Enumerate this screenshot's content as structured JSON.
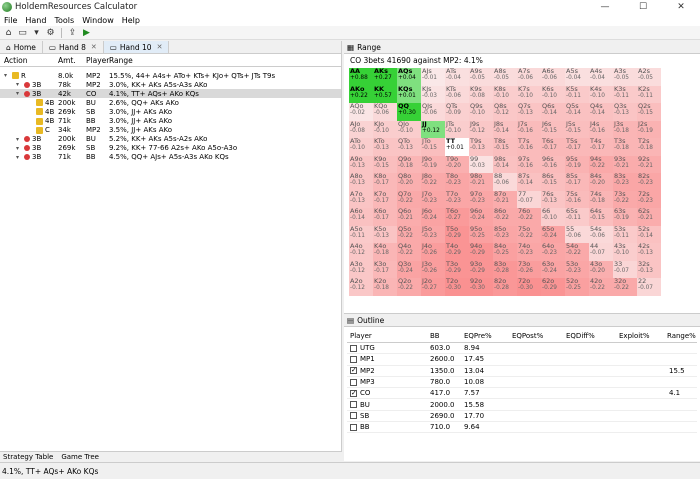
{
  "window": {
    "title": "HoldemResources Calculator"
  },
  "menu": [
    "File",
    "Hand",
    "Tools",
    "Window",
    "Help"
  ],
  "tabs": [
    {
      "label": "Home",
      "closable": false
    },
    {
      "label": "Hand 8",
      "closable": true
    },
    {
      "label": "Hand 10",
      "closable": true,
      "active": true
    }
  ],
  "tree_headers": [
    "Action",
    "Amt.",
    "Player",
    "Range"
  ],
  "tree_rows": [
    {
      "indent": 0,
      "marker": "lock",
      "action": "R",
      "amt": "8.0k",
      "player": "MP2",
      "range": "15.5%, 44+ A4s+ ATo+ KTs+ KJo+ QTs+ JTs T9s"
    },
    {
      "indent": 1,
      "marker": "dot",
      "action": "3B",
      "amt": "78k",
      "player": "MP2",
      "range": "3.0%, KK+ AKs A5s-A3s AKo"
    },
    {
      "indent": 1,
      "marker": "dot",
      "action": "3B",
      "amt": "42k",
      "player": "CO",
      "range": "4.1%, TT+ AQs+ AKo KQs",
      "selected": true
    },
    {
      "indent": 2,
      "marker": "lock",
      "action": "4B",
      "amt": "200k",
      "player": "BU",
      "range": "2.6%, QQ+ AKs AKo"
    },
    {
      "indent": 2,
      "marker": "lock",
      "action": "4B",
      "amt": "269k",
      "player": "SB",
      "range": "3.0%, JJ+ AKs AKo"
    },
    {
      "indent": 2,
      "marker": "lock",
      "action": "4B",
      "amt": "71k",
      "player": "BB",
      "range": "3.0%, JJ+ AKs AKo"
    },
    {
      "indent": 2,
      "marker": "lock",
      "action": "C",
      "amt": "34k",
      "player": "MP2",
      "range": "3.5%, JJ+ AKs AKo"
    },
    {
      "indent": 1,
      "marker": "dot",
      "action": "3B",
      "amt": "200k",
      "player": "BU",
      "range": "5.2%, KK+ AKs A5s-A2s AKo"
    },
    {
      "indent": 1,
      "marker": "dot",
      "action": "3B",
      "amt": "269k",
      "player": "SB",
      "range": "9.2%, KK+ 77-66 A2s+ AKo A5o-A3o"
    },
    {
      "indent": 1,
      "marker": "dot",
      "action": "3B",
      "amt": "71k",
      "player": "BB",
      "range": "4.5%, QQ+ AJs+ A5s-A3s AKo KQs"
    }
  ],
  "bottom_tabs": [
    "Strategy Table",
    "Game Tree"
  ],
  "range_panel": {
    "title": "Range",
    "subtitle": "CO 3bets 41690 against MP2: 4.1%",
    "hands": [
      [
        "AA",
        "AKs",
        "AQs",
        "AJs",
        "ATs",
        "A9s",
        "A8s",
        "A7s",
        "A6s",
        "A5s",
        "A4s",
        "A3s",
        "A2s"
      ],
      [
        "AKo",
        "KK",
        "KQs",
        "KJs",
        "KTs",
        "K9s",
        "K8s",
        "K7s",
        "K6s",
        "K5s",
        "K4s",
        "K3s",
        "K2s"
      ],
      [
        "AQo",
        "KQo",
        "QQ",
        "QJs",
        "QTs",
        "Q9s",
        "Q8s",
        "Q7s",
        "Q6s",
        "Q5s",
        "Q4s",
        "Q3s",
        "Q2s"
      ],
      [
        "AJo",
        "KJo",
        "QJo",
        "JJ",
        "JTs",
        "J9s",
        "J8s",
        "J7s",
        "J6s",
        "J5s",
        "J4s",
        "J3s",
        "J2s"
      ],
      [
        "ATo",
        "KTo",
        "QTo",
        "JTo",
        "TT",
        "T9s",
        "T8s",
        "T7s",
        "T6s",
        "T5s",
        "T4s",
        "T3s",
        "T2s"
      ],
      [
        "A9o",
        "K9o",
        "Q9o",
        "J9o",
        "T9o",
        "99",
        "98s",
        "97s",
        "96s",
        "95s",
        "94s",
        "93s",
        "92s"
      ],
      [
        "A8o",
        "K8o",
        "Q8o",
        "J8o",
        "T8o",
        "98o",
        "88",
        "87s",
        "86s",
        "85s",
        "84s",
        "83s",
        "82s"
      ],
      [
        "A7o",
        "K7o",
        "Q7o",
        "J7o",
        "T7o",
        "97o",
        "87o",
        "77",
        "76s",
        "75s",
        "74s",
        "73s",
        "72s"
      ],
      [
        "A6o",
        "K6o",
        "Q6o",
        "J6o",
        "T6o",
        "96o",
        "86o",
        "76o",
        "66",
        "65s",
        "64s",
        "63s",
        "62s"
      ],
      [
        "A5o",
        "K5o",
        "Q5o",
        "J5o",
        "T5o",
        "95o",
        "85o",
        "75o",
        "65o",
        "55",
        "54s",
        "53s",
        "52s"
      ],
      [
        "A4o",
        "K4o",
        "Q4o",
        "J4o",
        "T4o",
        "94o",
        "84o",
        "74o",
        "64o",
        "54o",
        "44",
        "43s",
        "42s"
      ],
      [
        "A3o",
        "K3o",
        "Q3o",
        "J3o",
        "T3o",
        "93o",
        "83o",
        "73o",
        "63o",
        "53o",
        "43o",
        "33",
        "32s"
      ],
      [
        "A2o",
        "K2o",
        "Q2o",
        "J2o",
        "T2o",
        "92o",
        "82o",
        "72o",
        "62o",
        "52o",
        "42o",
        "32o",
        "22"
      ]
    ],
    "values": [
      [
        "+0.88",
        "+0.27",
        "+0.04",
        "-0.01",
        "-0.04",
        "-0.05",
        "-0.05",
        "-0.06",
        "-0.06",
        "-0.04",
        "-0.04",
        "-0.05",
        "-0.05"
      ],
      [
        "+0.22",
        "+0.57",
        "+0.01",
        "-0.03",
        "-0.06",
        "-0.08",
        "-0.10",
        "-0.10",
        "-0.10",
        "-0.11",
        "-0.10",
        "-0.11",
        "-0.11"
      ],
      [
        "-0.02",
        "-0.06",
        "+0.30",
        "-0.06",
        "-0.09",
        "-0.10",
        "-0.12",
        "-0.13",
        "-0.14",
        "-0.14",
        "-0.14",
        "-0.13",
        "-0.15"
      ],
      [
        "-0.08",
        "-0.10",
        "-0.10",
        "+0.12",
        "-0.10",
        "-0.12",
        "-0.14",
        "-0.16",
        "-0.15",
        "-0.15",
        "-0.16",
        "-0.18",
        "-0.19"
      ],
      [
        "-0.10",
        "-0.13",
        "-0.13",
        "-0.15",
        "+0.01",
        "-0.13",
        "-0.15",
        "-0.16",
        "-0.17",
        "-0.17",
        "-0.17",
        "-0.18",
        "-0.18"
      ],
      [
        "-0.13",
        "-0.15",
        "-0.18",
        "-0.19",
        "-0.20",
        "-0.03",
        "-0.14",
        "-0.16",
        "-0.16",
        "-0.19",
        "-0.22",
        "-0.21",
        "-0.21"
      ],
      [
        "-0.13",
        "-0.17",
        "-0.20",
        "-0.22",
        "-0.23",
        "-0.21",
        "-0.06",
        "-0.14",
        "-0.15",
        "-0.17",
        "-0.20",
        "-0.23",
        "-0.23"
      ],
      [
        "-0.13",
        "-0.17",
        "-0.22",
        "-0.23",
        "-0.23",
        "-0.23",
        "-0.21",
        "-0.07",
        "-0.13",
        "-0.16",
        "-0.18",
        "-0.22",
        "-0.23"
      ],
      [
        "-0.14",
        "-0.17",
        "-0.21",
        "-0.24",
        "-0.27",
        "-0.24",
        "-0.22",
        "-0.22",
        "-0.10",
        "-0.11",
        "-0.15",
        "-0.19",
        "-0.21"
      ],
      [
        "-0.11",
        "-0.13",
        "-0.22",
        "-0.23",
        "-0.29",
        "-0.25",
        "-0.23",
        "-0.22",
        "-0.24",
        "-0.06",
        "-0.06",
        "-0.11",
        "-0.14"
      ],
      [
        "-0.12",
        "-0.18",
        "-0.22",
        "-0.26",
        "-0.29",
        "-0.29",
        "-0.25",
        "-0.23",
        "-0.23",
        "-0.22",
        "-0.07",
        "-0.10",
        "-0.13"
      ],
      [
        "-0.12",
        "-0.17",
        "-0.24",
        "-0.26",
        "-0.29",
        "-0.29",
        "-0.28",
        "-0.26",
        "-0.24",
        "-0.23",
        "-0.20",
        "-0.07",
        "-0.13"
      ],
      [
        "-0.12",
        "-0.18",
        "-0.22",
        "-0.27",
        "-0.30",
        "-0.30",
        "-0.28",
        "-0.30",
        "-0.29",
        "-0.25",
        "-0.22",
        "-0.22",
        "-0.07"
      ]
    ],
    "in_range": [
      "AA",
      "AKs",
      "AQs",
      "AKo",
      "KK",
      "KQs",
      "QQ",
      "JJ",
      "TT"
    ]
  },
  "outline": {
    "title": "Outline",
    "headers": [
      "Player",
      "BB",
      "EQPre%",
      "EQPost%",
      "EQDiff%",
      "Exploit%",
      "Range%"
    ],
    "rows": [
      {
        "checked": false,
        "player": "UTG",
        "bb": "603.0",
        "eqpre": "8.94",
        "range": ""
      },
      {
        "checked": false,
        "player": "MP1",
        "bb": "2600.0",
        "eqpre": "17.45",
        "range": ""
      },
      {
        "checked": true,
        "player": "MP2",
        "bb": "1350.0",
        "eqpre": "13.04",
        "range": "15.5"
      },
      {
        "checked": false,
        "player": "MP3",
        "bb": "780.0",
        "eqpre": "10.08",
        "range": ""
      },
      {
        "checked": true,
        "player": "CO",
        "bb": "417.0",
        "eqpre": "7.57",
        "range": "4.1"
      },
      {
        "checked": false,
        "player": "BU",
        "bb": "2000.0",
        "eqpre": "15.58",
        "range": ""
      },
      {
        "checked": false,
        "player": "SB",
        "bb": "2690.0",
        "eqpre": "17.70",
        "range": ""
      },
      {
        "checked": false,
        "player": "BB",
        "bb": "710.0",
        "eqpre": "9.64",
        "range": ""
      }
    ]
  },
  "status": "4.1%, TT+ AQs+ AKo KQs",
  "colors": {
    "in_range": "#7fe07f",
    "in_range_strong": "#36d136",
    "neg_light": "#fbdcdc",
    "neg_dark": "#f4a3a3",
    "selected_row": "#d9d9d9"
  }
}
